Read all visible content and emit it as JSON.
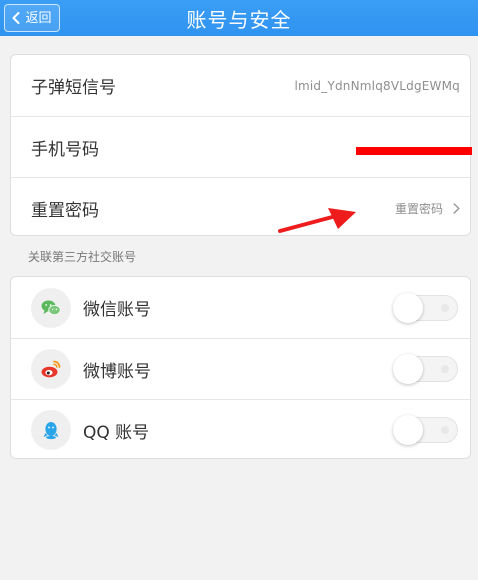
{
  "header": {
    "back_label": "返回",
    "title": "账号与安全"
  },
  "account": {
    "items": [
      {
        "label": "子弹短信号",
        "value": "lmid_YdnNmlq8VLdgEWMq"
      },
      {
        "label": "手机号码",
        "value": ""
      },
      {
        "label": "重置密码",
        "value": "重置密码"
      }
    ]
  },
  "social": {
    "section_title": "关联第三方社交账号",
    "items": [
      {
        "label": "微信账号",
        "icon": "wechat-icon",
        "enabled": false,
        "color": "#5cb85c"
      },
      {
        "label": "微博账号",
        "icon": "weibo-icon",
        "enabled": false,
        "color": "#e6372a"
      },
      {
        "label": "QQ 账号",
        "icon": "qq-icon",
        "enabled": false,
        "color": "#2ba5ea"
      }
    ]
  },
  "colors": {
    "header": "#3a9ef6",
    "background": "#f2f2f2",
    "redaction": "#ff0000",
    "arrow": "#ee1c1c"
  }
}
